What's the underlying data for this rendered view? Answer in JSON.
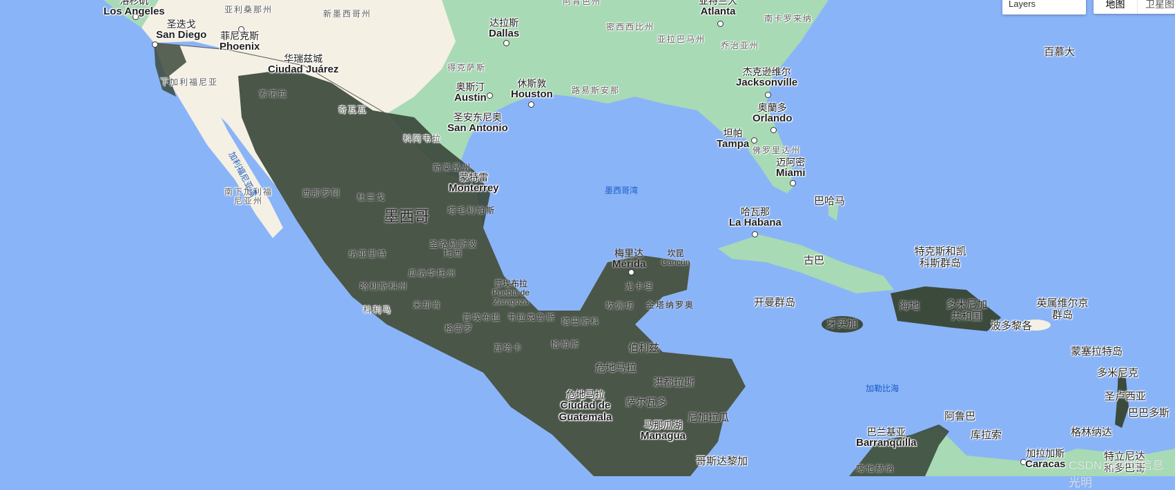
{
  "controls": {
    "layers_label": "Layers",
    "map_type_active": "地图",
    "map_type_inactive": "卫星图"
  },
  "watermark": "CSDN @地理信息光明",
  "colors": {
    "water": "#8ab4f8",
    "land_desert": "#f5f0e4",
    "land_green": "#a8dab5",
    "overlay_dark": "#3c4a3c",
    "roads": "#f9c44a"
  },
  "labels": {
    "los_angeles": {
      "zh": "洛杉矶",
      "en": "Los Angeles"
    },
    "san_diego": {
      "zh": "圣迭戈",
      "en": "San Diego"
    },
    "phoenix": {
      "zh": "菲尼克斯",
      "en": "Phoenix"
    },
    "ciudad_juarez": {
      "zh": "华瑞兹城",
      "en": "Ciudad Juárez"
    },
    "dallas": {
      "zh": "达拉斯",
      "en": "Dallas"
    },
    "austin": {
      "zh": "奥斯汀",
      "en": "Austin"
    },
    "houston": {
      "zh": "休斯敦",
      "en": "Houston"
    },
    "san_antonio": {
      "zh": "圣安东尼奥",
      "en": "San Antonio"
    },
    "monterrey": {
      "zh": "蒙特雷",
      "en": "Monterrey"
    },
    "atlanta": {
      "zh": "亚特兰大",
      "en": "Atlanta"
    },
    "jacksonville": {
      "zh": "杰克逊维尔",
      "en": "Jacksonville"
    },
    "orlando": {
      "zh": "奥蘭多",
      "en": "Orlando"
    },
    "tampa": {
      "zh": "坦帕",
      "en": "Tampa"
    },
    "miami": {
      "zh": "迈阿密",
      "en": "Miami"
    },
    "la_habana": {
      "zh": "哈瓦那",
      "en": "La Habana"
    },
    "merida": {
      "zh": "梅里达",
      "en": "Mérida"
    },
    "cancun": {
      "zh": "坎昆",
      "en": "Cancún"
    },
    "puebla": {
      "zh": "普埃布拉",
      "en": "Puebla de Zaragoza"
    },
    "guatemala_city": {
      "zh": "危地马拉",
      "en": "Ciudad de Guatemala"
    },
    "managua": {
      "zh": "马那瓜湖",
      "en": "Managua"
    },
    "barranquilla": {
      "zh": "巴兰基亚",
      "en": "Barranquilla"
    },
    "caracas": {
      "zh": "加拉加斯",
      "en": "Caracas"
    },
    "arizona": "亚利桑那州",
    "new_mexico": "新墨西哥州",
    "texas": "得克萨斯",
    "arkansas": "阿肯色州",
    "mississippi": "密西西比州",
    "alabama": "亚拉巴马州",
    "georgia": "乔治亚州",
    "south_carolina": "南卡罗来纳",
    "louisiana": "路易斯安那",
    "florida": "佛罗里达州",
    "baja_california": "下加利福尼亚",
    "baja_california_sur": "南下加利福尼亚州",
    "sonora": "索诺拉",
    "chihuahua": "奇瓦瓦",
    "coahuila": "科阿韦拉",
    "nuevo_leon": "新莱昂州",
    "sinaloa": "西那罗阿",
    "durango": "杜兰戈",
    "tamaulipas": "塔毛利帕斯",
    "slp": "圣路易斯波托西",
    "nayarit": "纳亚里特",
    "guanajuato": "瓜纳华托州",
    "jalisco": "哈利斯科州",
    "colima": "科利马",
    "michoacan": "米却肯",
    "puebla_state": "普埃布拉",
    "veracruz": "韦拉克鲁斯",
    "guerrero": "格雷罗",
    "oaxaca": "瓦哈卡",
    "tabasco": "塔巴斯科",
    "chiapas": "恰帕斯",
    "campeche": "坎佩切",
    "yucatan": "尤卡坦",
    "quintana_roo": "金塔纳罗奥",
    "mexico": "墨西哥",
    "belize": "伯利兹",
    "guatemala": "危地马拉",
    "honduras": "洪都拉斯",
    "el_salvador": "萨尔瓦多",
    "nicaragua": "尼加拉瓜",
    "costa_rica": "哥斯达黎加",
    "cuba": "古巴",
    "bahamas": "巴哈马",
    "turks_caicos": "特克斯和凯科斯群岛",
    "cayman": "开曼群岛",
    "jamaica": "牙买加",
    "haiti": "海地",
    "dominican_rep": "多米尼加共和国",
    "puerto_rico": "波多黎各",
    "bvi": "英属维尔京群岛",
    "montserrat": "蒙塞拉特岛",
    "dominica": "多米尼克",
    "st_lucia": "圣卢西亚",
    "barbados": "巴巴多斯",
    "grenada": "格林纳达",
    "trinidad": "特立尼达和多巴哥",
    "aruba": "阿鲁巴",
    "curacao": "库拉索",
    "bermuda": "百慕大",
    "cartagena": "喀他赫纳",
    "gulf_of_california": "加利福尼亚湾",
    "gulf_of_mexico": "墨西哥湾",
    "caribbean_sea": "加勒比海"
  }
}
